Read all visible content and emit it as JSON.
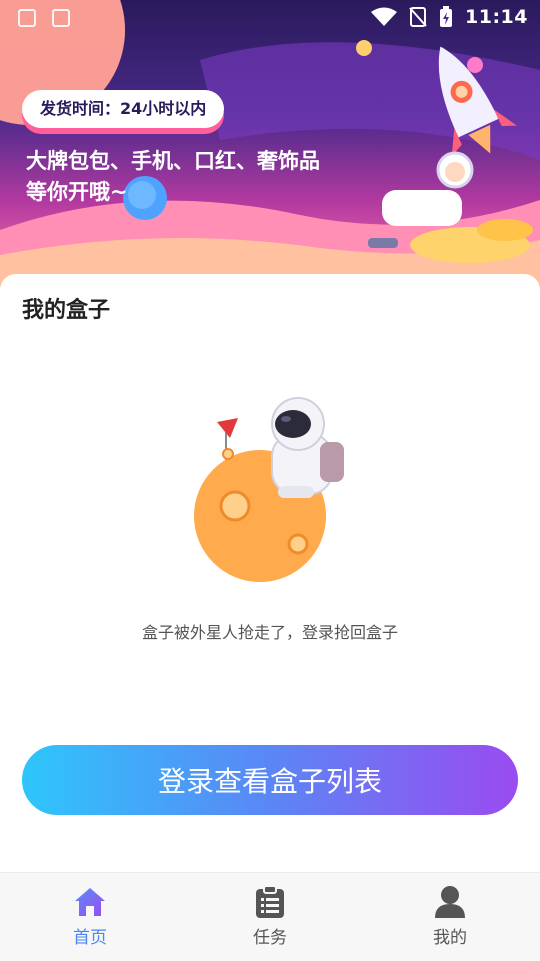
{
  "status_bar": {
    "time": "11:14"
  },
  "banner": {
    "pill_text": "发货时间：24小时以内",
    "slogan_line1": "大牌包包、手机、口红、奢饰品",
    "slogan_line2": "等你开哦~"
  },
  "my_box": {
    "title": "我的盒子",
    "empty_message": "盒子被外星人抢走了，登录抢回盒子",
    "login_button": "登录查看盒子列表"
  },
  "tabbar": {
    "items": [
      {
        "label": "首页",
        "icon": "home-icon",
        "active": true
      },
      {
        "label": "任务",
        "icon": "clipboard-icon",
        "active": false
      },
      {
        "label": "我的",
        "icon": "user-icon",
        "active": false
      }
    ]
  },
  "colors": {
    "accent": "#4a86f0",
    "button_gradient_start": "#2ec6fb",
    "button_gradient_end": "#9a4bf0",
    "pill_shadow": "#ff5f9a"
  }
}
